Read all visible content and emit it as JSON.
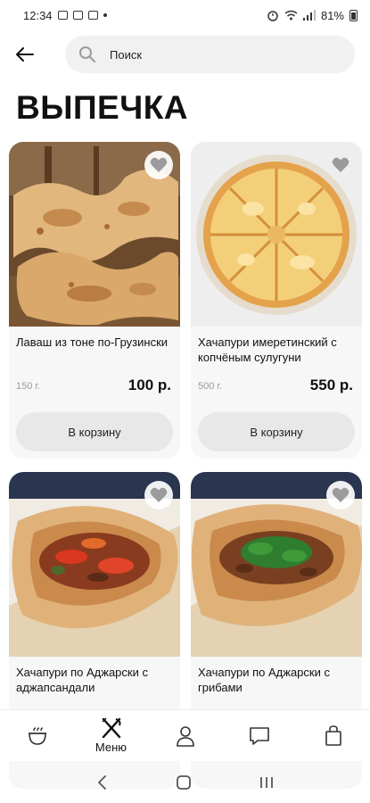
{
  "status_bar": {
    "time": "12:34",
    "battery_text": "81%"
  },
  "header": {
    "search_placeholder": "Поиск"
  },
  "page": {
    "title": "ВЫПЕЧКА"
  },
  "products": [
    {
      "name": "Лаваш из тоне по-Грузински",
      "weight": "150 г.",
      "price": "100 р.",
      "button": "В корзину",
      "favorite_icon": "heart-icon"
    },
    {
      "name": "Хачапури имеретинский с копчёным сулугуни",
      "weight": "500 г.",
      "price": "550 р.",
      "button": "В корзину",
      "favorite_icon": "heart-icon"
    },
    {
      "name": "Хачапури по Аджарски с аджапсандали",
      "favorite_icon": "heart-icon"
    },
    {
      "name": "Хачапури по Аджарски с грибами",
      "favorite_icon": "heart-icon"
    }
  ],
  "bottom_nav": {
    "items": [
      {
        "icon": "pot-icon",
        "label": ""
      },
      {
        "icon": "fork-knife-icon",
        "label": "Меню"
      },
      {
        "icon": "user-icon",
        "label": ""
      },
      {
        "icon": "chat-icon",
        "label": ""
      },
      {
        "icon": "bag-icon",
        "label": ""
      }
    ]
  },
  "colors": {
    "card_bg": "#f7f7f7",
    "button_bg": "#e8e8e8",
    "search_bg": "#f1f1f1",
    "heart": "#9b9b9b"
  }
}
